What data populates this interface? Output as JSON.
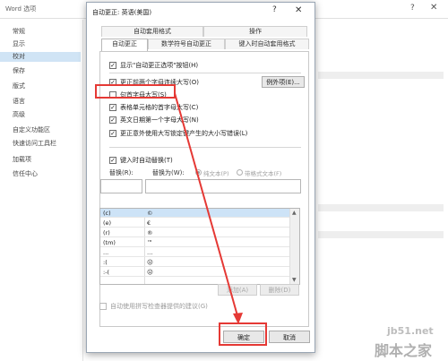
{
  "background_window": {
    "title": "Word 选项",
    "sidebar_items": [
      "常规",
      "显示",
      "校对",
      "保存",
      "版式",
      "语言",
      "高级",
      "自定义功能区",
      "快速访问工具栏",
      "加载项",
      "信任中心"
    ],
    "selected_item": "校对"
  },
  "dialog": {
    "title": "自动更正: 英语(美国)",
    "help_glyph": "?",
    "close_glyph": "✕",
    "tabs_row1": [
      "自动套用格式",
      "操作"
    ],
    "tabs_row2": [
      "自动更正",
      "数学符号自动更正",
      "键入时自动套用格式"
    ],
    "active_tab": "自动更正",
    "options": [
      {
        "label": "显示\"自动更正选项\"按钮(H)",
        "checked": true
      },
      {
        "label": "更正前两个字母连续大写(O)",
        "checked": true
      },
      {
        "label": "句首字母大写(S)",
        "checked": false
      },
      {
        "label": "表格单元格的首字母大写(C)",
        "checked": true
      },
      {
        "label": "英文日期第一个字母大写(N)",
        "checked": true
      },
      {
        "label": "更正意外使用大写锁定键产生的大小写错误(L)",
        "checked": true
      }
    ],
    "exceptions_button": "例外项(E)...",
    "replace_as_you_type": {
      "label": "键入时自动替换(T)",
      "checked": true
    },
    "replace_label": "替换(R):",
    "with_label": "替换为(W):",
    "radio_plain": "纯文本(P)",
    "radio_formatted": "带格式文本(F)",
    "list": [
      {
        "from": "(c)",
        "to": "©"
      },
      {
        "from": "(e)",
        "to": "€"
      },
      {
        "from": "(r)",
        "to": "®"
      },
      {
        "from": "(tm)",
        "to": "™"
      },
      {
        "from": "...",
        "to": "…"
      },
      {
        "from": ":(",
        "to": "☹"
      },
      {
        "from": ":-(",
        "to": "☹"
      }
    ],
    "add_button": "添加(A)",
    "delete_button": "删除(D)",
    "spell_checker_option": {
      "label": "自动使用拼写检查器提供的建议(G)",
      "checked": false
    },
    "ok_button": "确定",
    "cancel_button": "取消"
  },
  "watermark": {
    "site": "jb51.net",
    "brand": "脚本之家"
  },
  "colors": {
    "highlight_red": "#e53935",
    "selection_blue": "#cde3f7"
  }
}
